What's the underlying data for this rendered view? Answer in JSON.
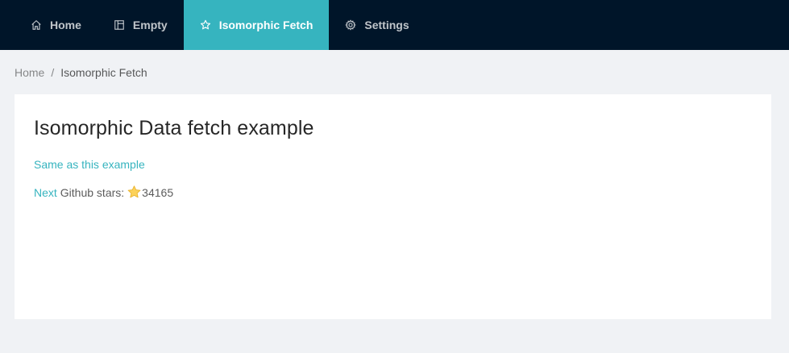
{
  "nav": {
    "items": [
      {
        "label": "Home",
        "icon": "home-icon"
      },
      {
        "label": "Empty",
        "icon": "layout-icon"
      },
      {
        "label": "Isomorphic Fetch",
        "icon": "star-outline-icon",
        "active": true
      },
      {
        "label": "Settings",
        "icon": "gear-icon"
      }
    ]
  },
  "breadcrumb": {
    "home": "Home",
    "separator": "/",
    "current": "Isomorphic Fetch"
  },
  "main": {
    "title": "Isomorphic Data fetch example",
    "example_link": "Same as this example",
    "next_link": "Next",
    "stars_label": "Github stars:",
    "stars_icon": "star-icon",
    "stars_count": "34165"
  },
  "colors": {
    "nav_bg": "#001529",
    "accent": "#36b4bf",
    "page_bg": "#f0f2f5"
  }
}
